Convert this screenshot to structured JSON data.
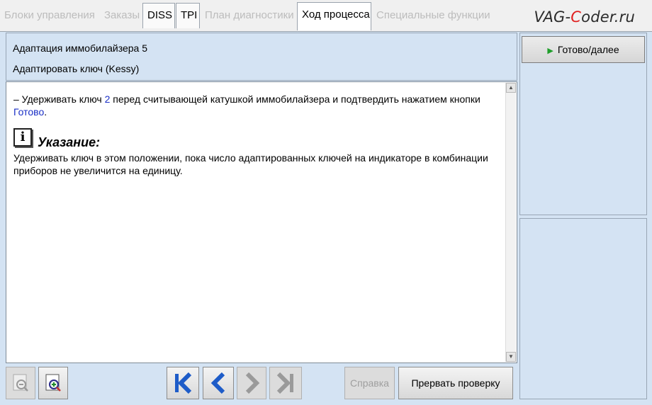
{
  "tabs": [
    {
      "label": "Блоки управления",
      "enabled": false
    },
    {
      "label": "Заказы",
      "enabled": false
    },
    {
      "label": "DISS",
      "enabled": true
    },
    {
      "label": "TPI",
      "enabled": true
    },
    {
      "label": "План диагностики",
      "enabled": false
    },
    {
      "label": "Ход процесса",
      "enabled": true,
      "active": true
    },
    {
      "label": "Специальные функции",
      "enabled": false
    }
  ],
  "watermark": {
    "prefix": "VAG-",
    "accent": "C",
    "suffix": "oder.ru"
  },
  "header": {
    "line1": "Адаптация иммобилайзера 5",
    "line2": "Адаптировать ключ (Kessy)"
  },
  "instruction": {
    "part1": "– Удерживать ключ ",
    "key_number": "2",
    "part2": " перед считывающей катушкой иммобилайзера и подтвердить нажатием кнопки ",
    "link": "Готово",
    "part3": "."
  },
  "note": {
    "icon": "info-icon",
    "title": "Указание:",
    "body": "Удерживать ключ в этом положении, пока число адаптированных ключей на индикаторе в комбинации приборов не увеличится на единицу."
  },
  "right_panel": {
    "done_label": "Готово/далее"
  },
  "toolbar": {
    "zoom_out_icon": "zoom-out-icon",
    "zoom_in_icon": "zoom-in-icon",
    "help_label": "Справка",
    "abort_label": "Прервать проверку"
  },
  "colors": {
    "accent_blue": "#1a2fc6",
    "play_green": "#1f9e2a",
    "nav_blue": "#1e5cc8",
    "watermark_red": "#e02020"
  }
}
